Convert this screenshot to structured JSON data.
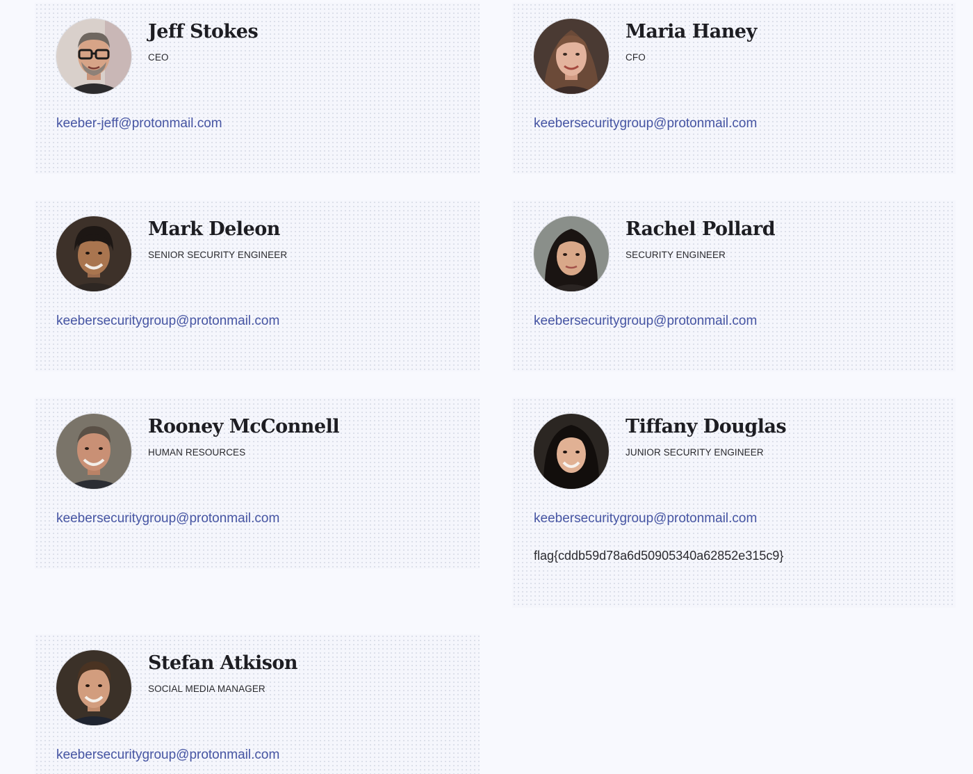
{
  "team": [
    {
      "name": "Jeff Stokes",
      "role": "CEO",
      "email": "keeber-jeff@protonmail.com",
      "avatar": "jeff-stokes-photo"
    },
    {
      "name": "Maria Haney",
      "role": "CFO",
      "email": "keebersecuritygroup@protonmail.com",
      "avatar": "maria-haney-photo"
    },
    {
      "name": "Mark Deleon",
      "role": "SENIOR SECURITY ENGINEER",
      "email": "keebersecuritygroup@protonmail.com",
      "avatar": "mark-deleon-photo"
    },
    {
      "name": "Rachel Pollard",
      "role": "SECURITY ENGINEER",
      "email": "keebersecuritygroup@protonmail.com",
      "avatar": "rachel-pollard-photo"
    },
    {
      "name": "Rooney McConnell",
      "role": "HUMAN RESOURCES",
      "email": "keebersecuritygroup@protonmail.com",
      "avatar": "rooney-mcconnell-photo"
    },
    {
      "name": "Tiffany Douglas",
      "role": "JUNIOR SECURITY ENGINEER",
      "email": "keebersecuritygroup@protonmail.com",
      "note": "flag{cddb59d78a6d50905340a62852e315c9}",
      "avatar": "tiffany-douglas-photo"
    },
    {
      "name": "Stefan Atkison",
      "role": "SOCIAL MEDIA MANAGER",
      "email": "keebersecuritygroup@protonmail.com",
      "avatar": "stefan-atkison-photo"
    }
  ],
  "colors": {
    "page_background": "#f8f9fe",
    "card_background": "#f5f6fc",
    "name_text": "#1d1d22",
    "link": "#4655a3"
  }
}
